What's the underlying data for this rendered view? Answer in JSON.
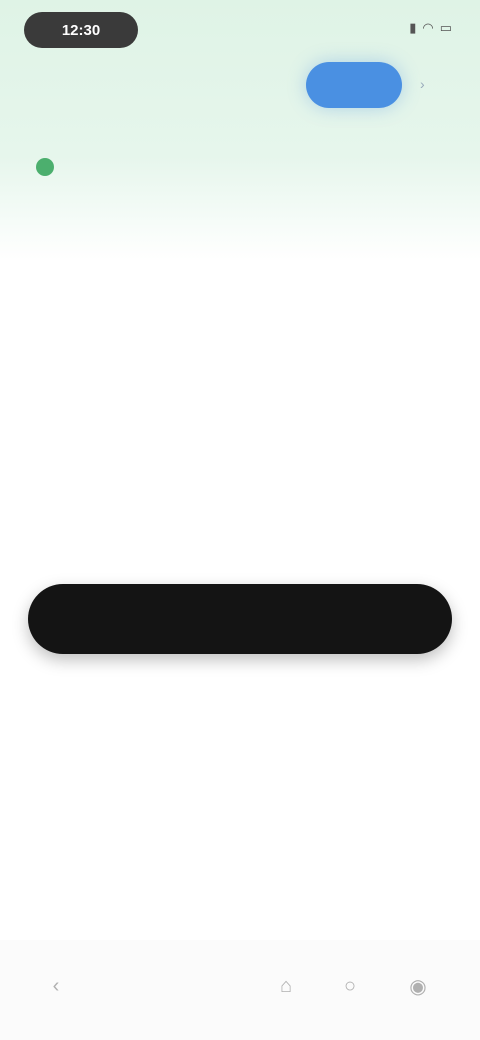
{
  "status_bar": {
    "time": "12:30",
    "icons": [
      "signal-icon",
      "wifi-icon",
      "battery-icon"
    ]
  },
  "header": {
    "left_text": "",
    "title": "",
    "action_label": "",
    "chevron_icon": "chevron-right-icon"
  },
  "notice": {
    "line1": "",
    "line2": ""
  },
  "main": {
    "title": "",
    "description": "",
    "primary_button_label": "",
    "link_primary": "",
    "link_secondary": "",
    "link_tertiary": ""
  },
  "bottom_nav": {
    "items": [
      {
        "icon": "back-icon"
      },
      {
        "icon": "home-icon"
      },
      {
        "icon": "search-icon"
      },
      {
        "icon": "profile-icon"
      }
    ]
  },
  "colors": {
    "accent_blue": "#4a90e2",
    "accent_green": "#4caf6e",
    "primary_button": "#141414",
    "header_gradient": "#dff3e6"
  }
}
